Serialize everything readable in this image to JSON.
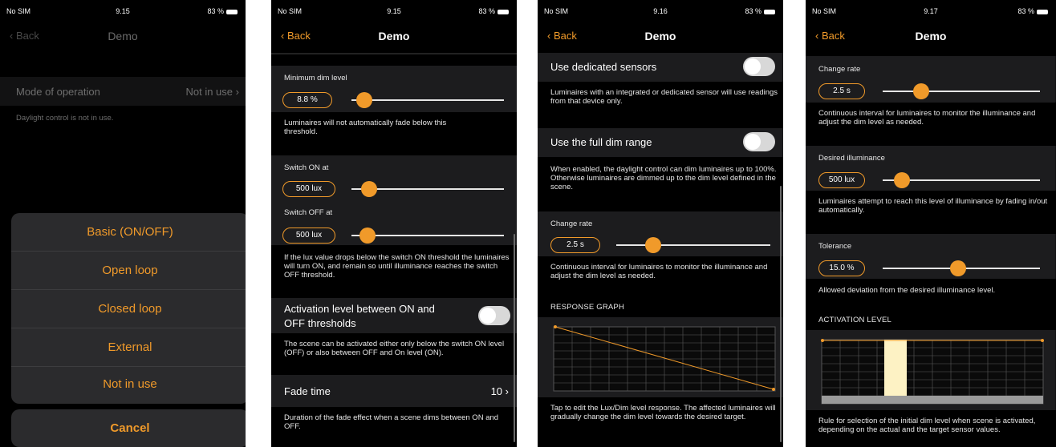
{
  "status": [
    {
      "carrier": "No SIM",
      "time": "9.15",
      "battery": "83 %"
    },
    {
      "carrier": "No SIM",
      "time": "9.15",
      "battery": "83 %"
    },
    {
      "carrier": "No SIM",
      "time": "9.16",
      "battery": "83 %"
    },
    {
      "carrier": "No SIM",
      "time": "9.17",
      "battery": "83 %"
    }
  ],
  "nav": {
    "back": "Back",
    "title": "Demo"
  },
  "screen1": {
    "mode_label": "Mode of operation",
    "mode_value": "Not in use",
    "mode_note": "Daylight control is not in use.",
    "options": [
      "Basic (ON/OFF)",
      "Open loop",
      "Closed loop",
      "External",
      "Not in use"
    ],
    "cancel": "Cancel"
  },
  "screen2": {
    "min_dim_label": "Minimum dim level",
    "min_dim_value": "8.8 %",
    "min_dim_note": "Luminaires will not automatically fade below this threshold.",
    "switch_on_label": "Switch ON at",
    "switch_on_value": "500 lux",
    "switch_off_label": "Switch OFF at",
    "switch_off_value": "500 lux",
    "switch_note": "If the lux value drops below the switch ON threshold the luminaires will turn ON, and remain so until illuminance reaches the switch OFF threshold.",
    "activation_label_1": "Activation level between ON and",
    "activation_label_2": "OFF thresholds",
    "activation_note": "The scene can be activated either only below the switch ON level (OFF) or also between OFF and On level (ON).",
    "fade_label": "Fade time",
    "fade_value": "10",
    "fade_note": "Duration of the fade effect when a scene dims between ON and OFF."
  },
  "screen3": {
    "sensors_label": "Use dedicated sensors",
    "sensors_note": "Luminaires with an integrated or dedicated sensor will use readings from that device only.",
    "fullrange_label": "Use the full dim range",
    "fullrange_note": "When enabled, the daylight control can dim luminaires up to 100%. Otherwise luminaires are dimmed up to the dim level defined in the scene.",
    "change_rate_label": "Change rate",
    "change_rate_value": "2.5 s",
    "change_rate_note": "Continuous interval for luminaires to monitor the illuminance and adjust the dim level as needed.",
    "graph_header": "RESPONSE GRAPH",
    "graph_note": "Tap to edit the Lux/Dim level response. The affected luminaires will gradually change the dim level towards the desired target."
  },
  "screen4": {
    "change_rate_label": "Change rate",
    "change_rate_value": "2.5 s",
    "change_rate_note": "Continuous interval for luminaires to monitor the illuminance and adjust the dim level as needed.",
    "desired_label": "Desired illuminance",
    "desired_value": "500 lux",
    "desired_note": "Luminaires attempt to reach this level of illuminance by fading in/out automatically.",
    "tolerance_label": "Tolerance",
    "tolerance_value": "15.0 %",
    "tolerance_note": "Allowed deviation from the desired illuminance level.",
    "activation_header": "ACTIVATION LEVEL",
    "activation_note": "Rule for selection of the initial dim level when scene is activated, depending on the actual and the target sensor values."
  },
  "colors": {
    "accent": "#f09a2a",
    "background": "#000000",
    "row": "#1c1c1e",
    "sheet": "#2b2b2d"
  }
}
